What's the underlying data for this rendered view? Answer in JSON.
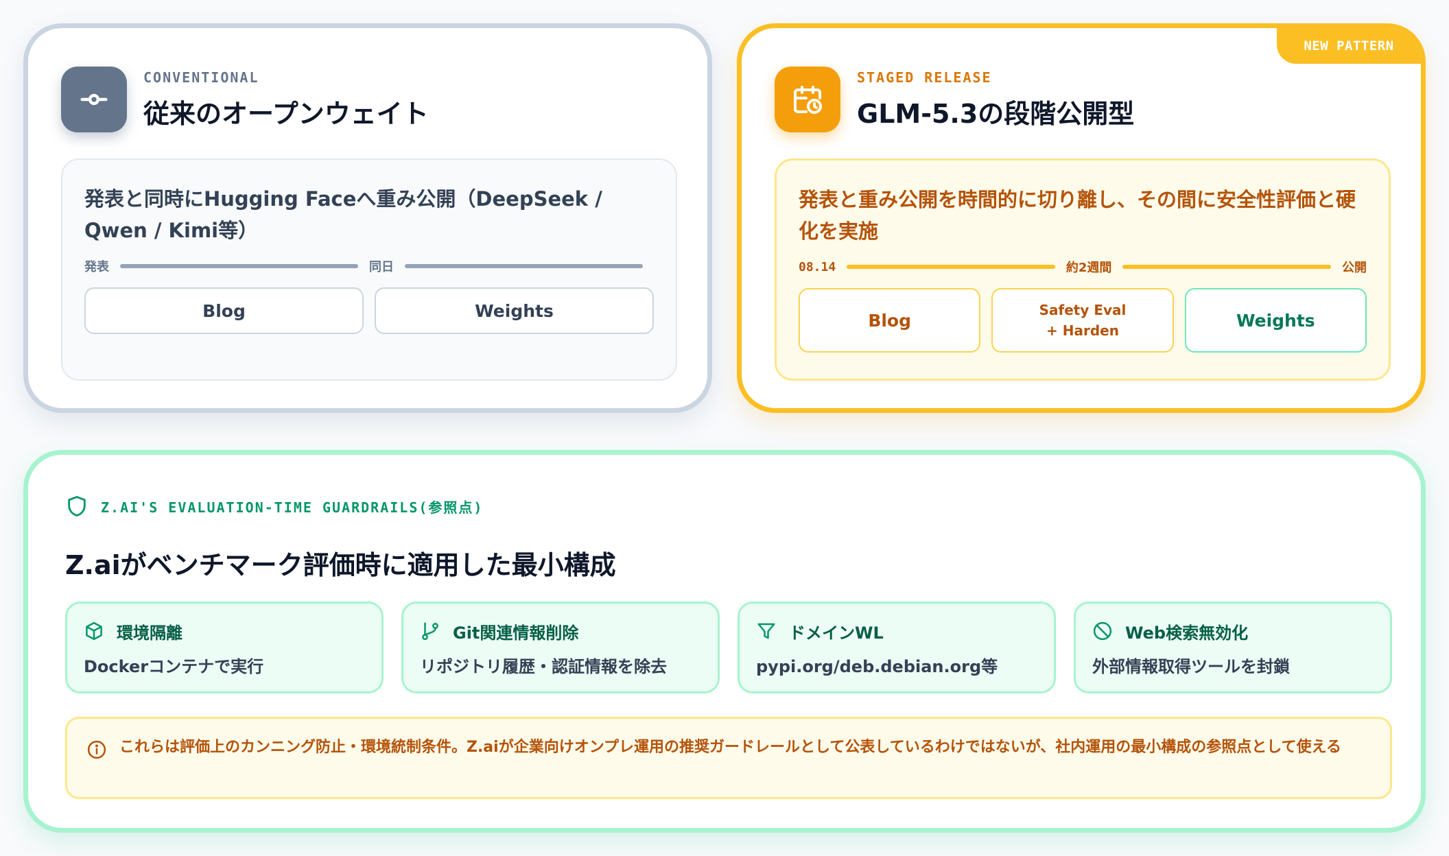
{
  "conventional": {
    "eyebrow": "CONVENTIONAL",
    "title": "従来のオープンウェイト",
    "icon": "commit-icon",
    "description": "発表と同時にHugging Faceへ重み公開（DeepSeek / Qwen / Kimi等）",
    "timeline": {
      "start": "発表",
      "mid": "同日"
    },
    "steps": [
      "Blog",
      "Weights"
    ]
  },
  "staged": {
    "badge": "NEW PATTERN",
    "eyebrow": "STAGED RELEASE",
    "title": "GLM-5.3の段階公開型",
    "icon": "calendar-clock-icon",
    "description": "発表と重み公開を時間的に切り離し、その間に安全性評価と硬化を実施",
    "timeline": {
      "start": "08.14",
      "mid": "約2週間",
      "end": "公開"
    },
    "steps": {
      "blog": "Blog",
      "safety_line1": "Safety Eval",
      "safety_line2": "+ Harden",
      "weights": "Weights"
    }
  },
  "guardrails": {
    "eyebrow": "Z.AI'S EVALUATION-TIME GUARDRAILS(参照点)",
    "title": "Z.aiがベンチマーク評価時に適用した最小構成",
    "items": [
      {
        "icon": "box-icon",
        "title": "環境隔離",
        "desc": "Dockerコンテナで実行"
      },
      {
        "icon": "git-branch-icon",
        "title": "Git関連情報削除",
        "desc": "リポジトリ履歴・認証情報を除去"
      },
      {
        "icon": "filter-icon",
        "title": "ドメインWL",
        "desc": "pypi.org/deb.debian.org等"
      },
      {
        "icon": "ban-icon",
        "title": "Web検索無効化",
        "desc": "外部情報取得ツールを封鎖"
      }
    ],
    "note": "これらは評価上のカンニング防止・環境統制条件。Z.aiが企業向けオンプレ運用の推奨ガードレールとして公表しているわけではないが、社内運用の最小構成の参照点として使える"
  },
  "colors": {
    "slate": "#64748b",
    "amber": "#f59e0b",
    "emerald": "#059669",
    "amber_text": "#b45309"
  }
}
